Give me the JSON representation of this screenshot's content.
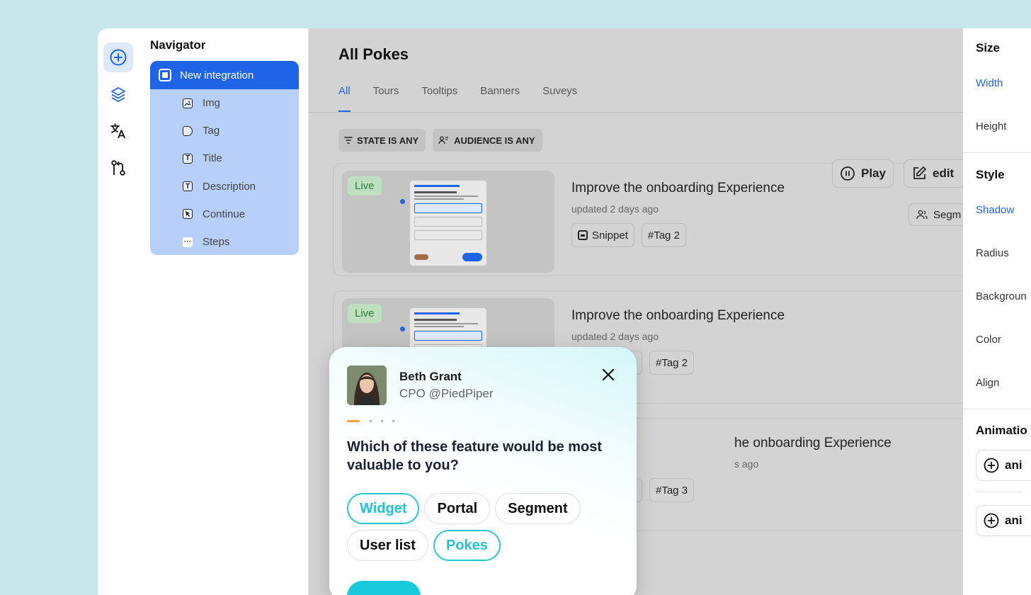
{
  "rail": {
    "icons": [
      "plus-circle-icon",
      "layers-icon",
      "translate-icon",
      "git-flow-icon"
    ]
  },
  "navigator": {
    "title": "Navigator",
    "root": {
      "label": "New integration",
      "icon": "block-icon"
    },
    "items": [
      {
        "label": "Img",
        "icon": "image-icon"
      },
      {
        "label": "Tag",
        "icon": "tag-icon"
      },
      {
        "label": "Title",
        "icon": "text-icon",
        "glyph": "T"
      },
      {
        "label": "Description",
        "icon": "text-icon",
        "glyph": "T"
      },
      {
        "label": "Continue",
        "icon": "cursor-icon"
      },
      {
        "label": "Steps",
        "icon": "dots-icon",
        "glyph": "···"
      }
    ]
  },
  "main": {
    "title": "All Pokes",
    "tabs": [
      "All",
      "Tours",
      "Tooltips",
      "Banners",
      "Suveys"
    ],
    "active_tab": "All",
    "filters": [
      "STATE IS ANY",
      "AUDIENCE IS ANY"
    ],
    "cards": [
      {
        "status": "Live",
        "title": "Improve the onboarding Experience",
        "updated": "updated 2 days ago",
        "chips": [
          "Snippet",
          "#Tag 2"
        ],
        "actions": [
          "Play",
          "edit"
        ],
        "segment": "Segm"
      },
      {
        "status": "Live",
        "title": "Improve the onboarding Experience",
        "updated": "updated 2 days ago",
        "chips": [
          "",
          "#Tag 2"
        ]
      },
      {
        "title_partial": "he onboarding Experience",
        "updated_partial": "s ago",
        "chips": [
          "",
          "#Tag 3"
        ]
      }
    ]
  },
  "right_panel": {
    "size_heading": "Size",
    "width_label": "Width",
    "height_label": "Height",
    "style_heading": "Style",
    "shadow_label": "Shadow",
    "radius_label": "Radius",
    "background_label": "Backgroun",
    "color_label": "Color",
    "align_label": "Align",
    "animation_heading": "Animatio",
    "animation_buttons": [
      "ani",
      "ani"
    ]
  },
  "popup": {
    "name": "Beth Grant",
    "role": "CPO @PiedPiper",
    "question": "Which of these feature would be most valuable to you?",
    "options": [
      {
        "label": "Widget",
        "selected": true
      },
      {
        "label": "Portal",
        "selected": false
      },
      {
        "label": "Segment",
        "selected": false
      },
      {
        "label": "User list",
        "selected": false
      },
      {
        "label": "Pokes",
        "selected": true
      }
    ],
    "progress": {
      "current": 1,
      "total": 4
    }
  },
  "colors": {
    "accent": "#1f63e6",
    "teal": "#22c3d3",
    "live": "#2c7a3e",
    "background": "#c7e6ec"
  }
}
